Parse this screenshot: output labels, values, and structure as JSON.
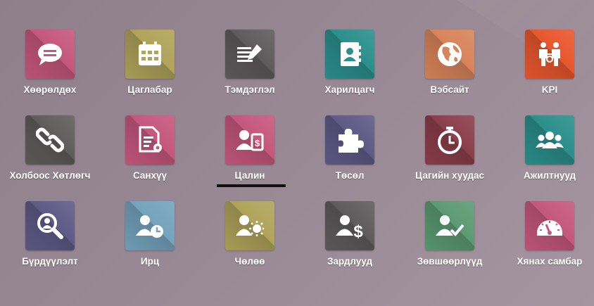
{
  "apps": [
    {
      "label": "Хөөрөлдөх",
      "icon": "chat-bubble-icon",
      "color": "#c5577c"
    },
    {
      "label": "Цаглабар",
      "icon": "calendar-icon",
      "color": "#b0a35a"
    },
    {
      "label": "Тэмдэглэл",
      "icon": "notes-pencil-icon",
      "color": "#5f5b5d"
    },
    {
      "label": "Харилцагч",
      "icon": "contact-book-icon",
      "color": "#2b8f8c"
    },
    {
      "label": "Вэбсайт",
      "icon": "globe-icon",
      "color": "#d8845a"
    },
    {
      "label": "KPI",
      "icon": "kpi-people-icon",
      "color": "#e8572e"
    },
    {
      "label": "Холбоос Хөтлөгч",
      "icon": "link-icon",
      "color": "#5e5d5b"
    },
    {
      "label": "Санхүү",
      "icon": "invoice-gear-icon",
      "color": "#c5577c"
    },
    {
      "label": "Цалин",
      "icon": "payroll-icon",
      "color": "#c5577c"
    },
    {
      "label": "Төсөл",
      "icon": "puzzle-icon",
      "color": "#5f5a86"
    },
    {
      "label": "Цагийн хуудас",
      "icon": "stopwatch-icon",
      "color": "#8b3e4b"
    },
    {
      "label": "Ажилтнууд",
      "icon": "team-icon",
      "color": "#2b8f8c"
    },
    {
      "label": "Бүрдүүлэлт",
      "icon": "magnifier-icon",
      "color": "#5f5a86"
    },
    {
      "label": "Ирц",
      "icon": "user-clock-icon",
      "color": "#74a3bd"
    },
    {
      "label": "Чөлөө",
      "icon": "user-sun-icon",
      "color": "#b0a35a"
    },
    {
      "label": "Зардлууд",
      "icon": "user-dollar-icon",
      "color": "#5f5b5d"
    },
    {
      "label": "Зөвшөөрлүүд",
      "icon": "user-check-icon",
      "color": "#5c9a73"
    },
    {
      "label": "Хянах самбар",
      "icon": "gauge-icon",
      "color": "#c5577c"
    }
  ],
  "active_app": "Цалин"
}
